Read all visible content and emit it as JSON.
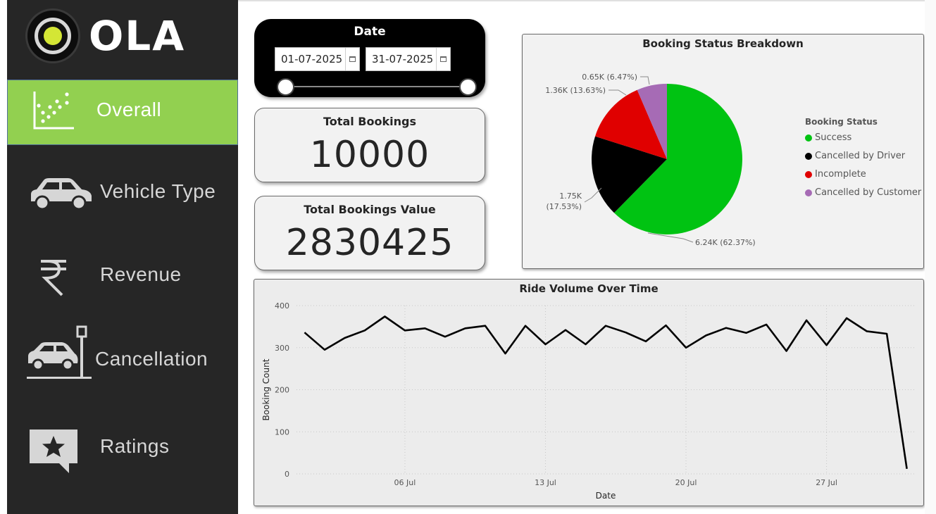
{
  "brand": {
    "name": "OLA",
    "colors": {
      "sidebar": "#262626",
      "active_nav": "#92d050",
      "logo_dot": "#d4e635"
    }
  },
  "sidebar": {
    "items": [
      {
        "label": "Overall",
        "icon": "scatter-chart-icon",
        "active": true
      },
      {
        "label": "Vehicle Type",
        "icon": "car-icon",
        "active": false
      },
      {
        "label": "Revenue",
        "icon": "rupee-icon",
        "active": false
      },
      {
        "label": "Cancellation",
        "icon": "car-crash-icon",
        "active": false
      },
      {
        "label": "Ratings",
        "icon": "star-speech-bubble-icon",
        "active": false
      }
    ]
  },
  "date_filter": {
    "title": "Date",
    "start": "01-07-2025",
    "end": "31-07-2025"
  },
  "kpis": {
    "total_bookings": {
      "label": "Total Bookings",
      "value": "10000"
    },
    "total_value": {
      "label": "Total Bookings Value",
      "value": "2830425"
    }
  },
  "chart_data": [
    {
      "type": "pie",
      "title": "Booking Status Breakdown",
      "legend_title": "Booking Status",
      "legend_position": "right",
      "slices": [
        {
          "name": "Success",
          "value": 6237,
          "label": "6.24K (62.37%)",
          "color": "#00c312"
        },
        {
          "name": "Cancelled by Driver",
          "value": 1753,
          "label_line1": "1.75K",
          "label_line2": "(17.53%)",
          "color": "#000000"
        },
        {
          "name": "Incomplete",
          "value": 1363,
          "label": "1.36K (13.63%)",
          "color": "#e00000"
        },
        {
          "name": "Cancelled by Customer",
          "value": 647,
          "label": "0.65K (6.47%)",
          "color": "#a66bb5"
        }
      ]
    },
    {
      "type": "line",
      "title": "Ride Volume Over Time",
      "xlabel": "Date",
      "ylabel": "Booking Count",
      "ylim": [
        0,
        400
      ],
      "yticks": [
        0,
        100,
        200,
        300,
        400
      ],
      "xticks": [
        {
          "day": 6,
          "label": "06 Jul"
        },
        {
          "day": 13,
          "label": "13 Jul"
        },
        {
          "day": 20,
          "label": "20 Jul"
        },
        {
          "day": 27,
          "label": "27 Jul"
        }
      ],
      "grid": true,
      "series": [
        {
          "color": "#000000",
          "x": [
            1,
            2,
            3,
            4,
            5,
            6,
            7,
            8,
            9,
            10,
            11,
            12,
            13,
            14,
            15,
            16,
            17,
            18,
            19,
            20,
            21,
            22,
            23,
            24,
            25,
            26,
            27,
            28,
            29,
            30,
            31
          ],
          "y": [
            336,
            295,
            323,
            341,
            374,
            341,
            346,
            326,
            346,
            352,
            286,
            352,
            308,
            342,
            308,
            352,
            336,
            315,
            353,
            300,
            329,
            347,
            335,
            355,
            292,
            365,
            306,
            370,
            339,
            333,
            12
          ]
        }
      ]
    }
  ]
}
